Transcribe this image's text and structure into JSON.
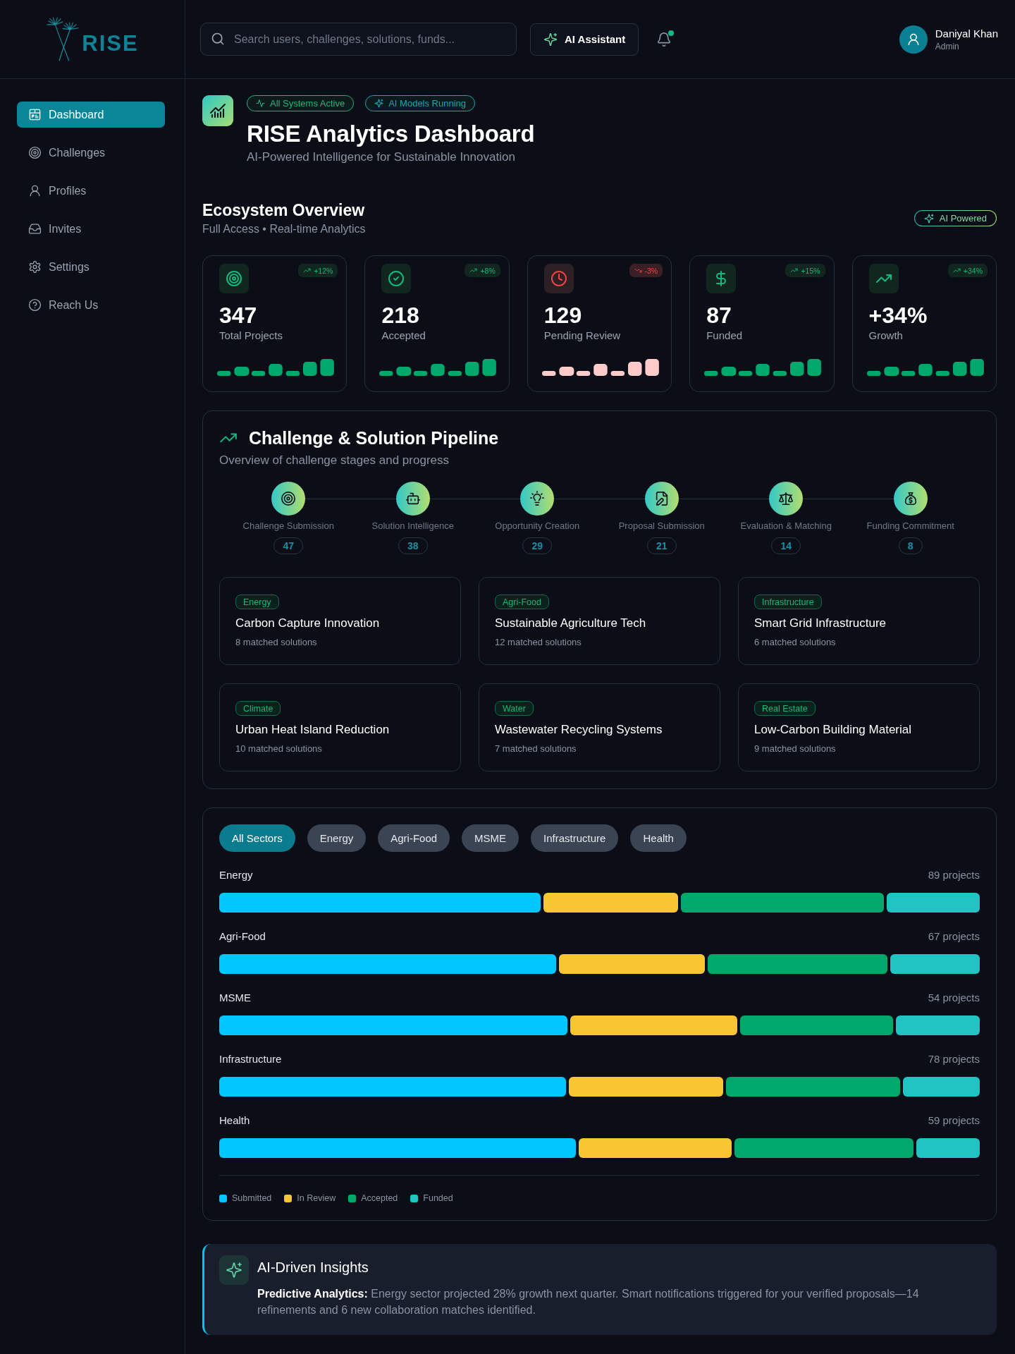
{
  "logo": {
    "text": "RISE"
  },
  "search": {
    "placeholder": "Search users, challenges, solutions, funds..."
  },
  "assistant_button": {
    "label": "AI Assistant"
  },
  "notifications": {
    "unread": true
  },
  "user": {
    "name": "Daniyal Khan",
    "role": "Admin"
  },
  "sidebar": {
    "items": [
      {
        "label": "Dashboard",
        "selected": true
      },
      {
        "label": "Challenges",
        "selected": false
      },
      {
        "label": "Profiles",
        "selected": false
      },
      {
        "label": "Invites",
        "selected": false
      },
      {
        "label": "Settings",
        "selected": false
      },
      {
        "label": "Reach Us",
        "selected": false
      }
    ]
  },
  "header": {
    "badges": [
      {
        "label": "All Systems Active",
        "color": "#22b67a"
      },
      {
        "label": "AI Models Running",
        "color": "#1ba3b8"
      }
    ],
    "title": "RISE Analytics Dashboard",
    "subtitle": "AI-Powered Intelligence for Sustainable Innovation"
  },
  "overview": {
    "title": "Ecosystem Overview",
    "subtitle": "Full Access • Real-time Analytics",
    "badge": "AI Powered",
    "stats": [
      {
        "value": "347",
        "label": "Total Projects",
        "change": "+12%",
        "falling": false
      },
      {
        "value": "218",
        "label": "Accepted",
        "change": "+8%",
        "falling": false
      },
      {
        "value": "129",
        "label": "Pending Review",
        "change": "-3%",
        "falling": true
      },
      {
        "value": "87",
        "label": "Funded",
        "change": "+15%",
        "falling": false
      },
      {
        "value": "+34%",
        "label": "Growth",
        "change": "+34%",
        "falling": false
      }
    ]
  },
  "pipeline": {
    "title": "Challenge & Solution Pipeline",
    "subtitle": "Overview of challenge stages and progress",
    "stages": [
      {
        "label": "Challenge Submission",
        "count": "47"
      },
      {
        "label": "Solution Intelligence",
        "count": "38"
      },
      {
        "label": "Opportunity Creation",
        "count": "29"
      },
      {
        "label": "Proposal Submission",
        "count": "21"
      },
      {
        "label": "Evaluation & Matching",
        "count": "14"
      },
      {
        "label": "Funding Commitment",
        "count": "8"
      }
    ],
    "challenges": [
      {
        "tag": "Energy",
        "title": "Carbon Capture Innovation",
        "matches": "8 matched solutions"
      },
      {
        "tag": "Agri-Food",
        "title": "Sustainable Agriculture Tech",
        "matches": "12 matched solutions"
      },
      {
        "tag": "Infrastructure",
        "title": "Smart Grid Infrastructure",
        "matches": "6 matched solutions"
      },
      {
        "tag": "Climate",
        "title": "Urban Heat Island Reduction",
        "matches": "10 matched solutions"
      },
      {
        "tag": "Water",
        "title": "Wastewater Recycling Systems",
        "matches": "7 matched solutions"
      },
      {
        "tag": "Real Estate",
        "title": "Low-Carbon Building Material",
        "matches": "9 matched solutions"
      }
    ]
  },
  "sectors": {
    "filters": [
      {
        "label": "All Sectors",
        "selected": true
      },
      {
        "label": "Energy",
        "selected": false
      },
      {
        "label": "Agri-Food",
        "selected": false
      },
      {
        "label": "MSME",
        "selected": false
      },
      {
        "label": "Infrastructure",
        "selected": false
      },
      {
        "label": "Health",
        "selected": false
      }
    ],
    "rows": [
      {
        "label": "Energy",
        "count": "89 projects"
      },
      {
        "label": "Agri-Food",
        "count": "67 projects"
      },
      {
        "label": "MSME",
        "count": "54 projects"
      },
      {
        "label": "Infrastructure",
        "count": "78 projects"
      },
      {
        "label": "Health",
        "count": "59 projects"
      }
    ],
    "legend": [
      {
        "label": "Submitted",
        "color": "#00c8ff"
      },
      {
        "label": "In Review",
        "color": "#f8c632"
      },
      {
        "label": "Accepted",
        "color": "#00a86b"
      },
      {
        "label": "Funded",
        "color": "#22c3c3"
      }
    ]
  },
  "insights": {
    "title": "AI-Driven Insights",
    "text": "**Predictive Analytics:** Energy sector projected 28% growth next quarter. Smart notifications triggered for your verified proposals—14 refinements and 6 new collaboration matches identified."
  }
}
